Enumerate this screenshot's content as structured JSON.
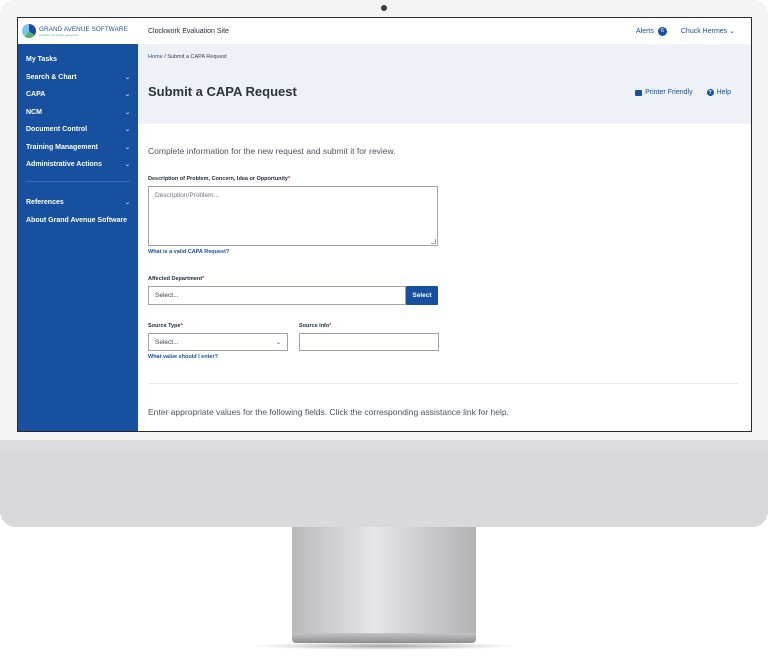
{
  "logo": {
    "name": "GRAND AVENUE SOFTWARE",
    "tagline": "software for quality assurance"
  },
  "topbar": {
    "site_name": "Clockwork Evaluation Site",
    "alerts_label": "Alerts",
    "alerts_count": "6",
    "user_name": "Chuck Hermes"
  },
  "sidebar": {
    "items": [
      {
        "label": "My Tasks",
        "chevron": false
      },
      {
        "label": "Search & Chart",
        "chevron": true
      },
      {
        "label": "CAPA",
        "chevron": true
      },
      {
        "label": "NCM",
        "chevron": true
      },
      {
        "label": "Document Control",
        "chevron": true
      },
      {
        "label": "Training Management",
        "chevron": true
      },
      {
        "label": "Administrative Actions",
        "chevron": true
      }
    ],
    "items2": [
      {
        "label": "References",
        "chevron": true
      },
      {
        "label": "About Grand Avenue Software",
        "chevron": false
      }
    ]
  },
  "breadcrumb": {
    "home": "Home",
    "separator": "/",
    "current": "Submit a CAPA Request"
  },
  "page": {
    "title": "Submit a CAPA Request",
    "printer_friendly": "Printer Friendly",
    "help": "Help"
  },
  "form": {
    "intro": "Complete information for the new request and submit it for review.",
    "description": {
      "label": "Description of Problem, Concern, Idea or Opportunity",
      "placeholder": "Description/Problem...",
      "help": "What is a valid CAPA Request?"
    },
    "department": {
      "label": "Affected Department",
      "value": "Select...",
      "button": "Select"
    },
    "source_type": {
      "label": "Source Type",
      "value": "Select...",
      "help": "What value should I enter?"
    },
    "source_info": {
      "label": "Source Info",
      "value": ""
    },
    "outro": "Enter appropriate values for the following fields. Click the corresponding assistance link for help."
  },
  "colors": {
    "brand": "#17509f",
    "required": "#d31f26"
  }
}
